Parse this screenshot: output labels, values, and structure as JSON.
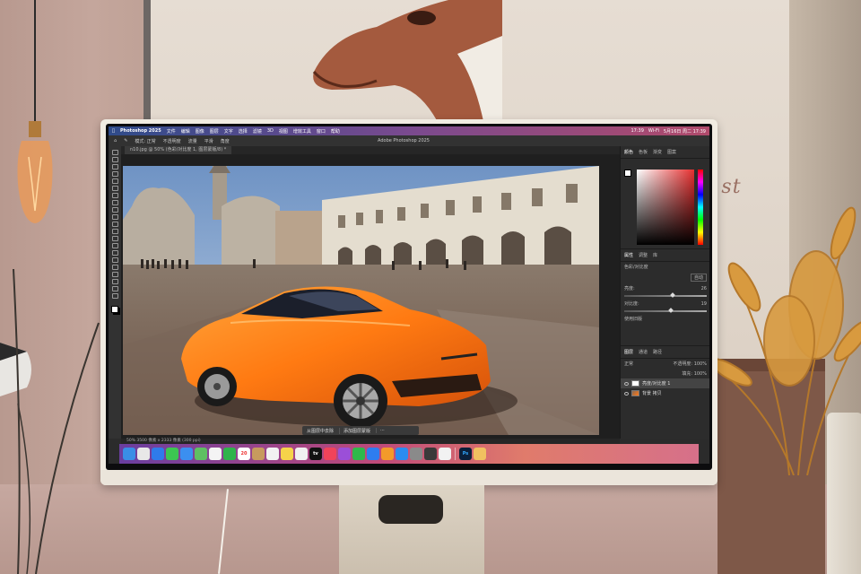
{
  "scene": {
    "poster_script": "Ari  st"
  },
  "mac_menubar": {
    "app": "Photoshop 2025",
    "menus": [
      "文件",
      "编辑",
      "图像",
      "图层",
      "文字",
      "选择",
      "滤镜",
      "3D",
      "视图",
      "增效工具",
      "窗口",
      "帮助"
    ],
    "right_items": [
      "17:39",
      "Wi-Fi",
      "5月16日 周二  17:39"
    ]
  },
  "photoshop": {
    "window_title": "Adobe Photoshop 2025",
    "options_bar": [
      "模式: 正常",
      "不透明度",
      "流量",
      "平滑",
      "角度"
    ],
    "document_tab": "n10.jpg @ 50% (色彩/对比度 1, 图层蒙版/8) *",
    "panel_tabs_top": [
      "颜色",
      "色板",
      "渐变",
      "图案"
    ],
    "properties_tabs": [
      "属性",
      "调整",
      "库"
    ],
    "properties_title": "色彩/对比度",
    "properties": [
      {
        "label": "自动",
        "value": ""
      },
      {
        "label": "亮度:",
        "value": "26"
      },
      {
        "label": "对比度:",
        "value": "19"
      }
    ],
    "use_legacy": "使用旧版",
    "layers_tabs": [
      "图层",
      "通道",
      "路径"
    ],
    "blend_mode": "正常",
    "opacity_label": "不透明度: 100%",
    "fill_label": "填充: 100%",
    "layers": [
      {
        "name": "亮度/对比度 1",
        "type": "adjustment",
        "selected": true
      },
      {
        "name": "背景 拷贝",
        "type": "photo",
        "selected": false
      }
    ],
    "status_text": "50%    3500 像素 x 2333 像素 (300 ppi)",
    "context_bar": [
      "从图层中去除",
      "添加图层蒙版"
    ]
  },
  "dock": {
    "icons": [
      {
        "name": "finder",
        "color": "#3a8ee6",
        "glyph": ""
      },
      {
        "name": "launchpad",
        "color": "#e8e8e8",
        "glyph": ""
      },
      {
        "name": "safari",
        "color": "#2f7bea",
        "glyph": ""
      },
      {
        "name": "messages",
        "color": "#3cc651",
        "glyph": ""
      },
      {
        "name": "mail",
        "color": "#3b8ff0",
        "glyph": ""
      },
      {
        "name": "maps",
        "color": "#5fbf62",
        "glyph": ""
      },
      {
        "name": "photos",
        "color": "#f4f4f4",
        "glyph": ""
      },
      {
        "name": "facetime",
        "color": "#2fb34c",
        "glyph": ""
      },
      {
        "name": "calendar",
        "color": "#ffffff",
        "glyph": "20"
      },
      {
        "name": "contacts",
        "color": "#c79a5e",
        "glyph": ""
      },
      {
        "name": "reminders",
        "color": "#f2f2f2",
        "glyph": ""
      },
      {
        "name": "notes",
        "color": "#f6d34a",
        "glyph": ""
      },
      {
        "name": "freeform",
        "color": "#f0f0f0",
        "glyph": ""
      },
      {
        "name": "tv",
        "color": "#111111",
        "glyph": "tv"
      },
      {
        "name": "music",
        "color": "#f0435a",
        "glyph": ""
      },
      {
        "name": "podcasts",
        "color": "#9b4fd8",
        "glyph": ""
      },
      {
        "name": "numbers",
        "color": "#2fb94a",
        "glyph": ""
      },
      {
        "name": "keynote",
        "color": "#2e7df0",
        "glyph": ""
      },
      {
        "name": "pages",
        "color": "#f39a2a",
        "glyph": ""
      },
      {
        "name": "app-store",
        "color": "#2a8cf0",
        "glyph": ""
      },
      {
        "name": "system-settings",
        "color": "#8a8a8a",
        "glyph": ""
      },
      {
        "name": "iphone-mirroring",
        "color": "#3a3a3a",
        "glyph": ""
      },
      {
        "name": "chrome",
        "color": "#f2f2f2",
        "glyph": ""
      },
      {
        "name": "photoshop",
        "color": "#0b1f3a",
        "glyph": "Ps"
      },
      {
        "name": "finder-2",
        "color": "#f0c060",
        "glyph": ""
      }
    ]
  }
}
